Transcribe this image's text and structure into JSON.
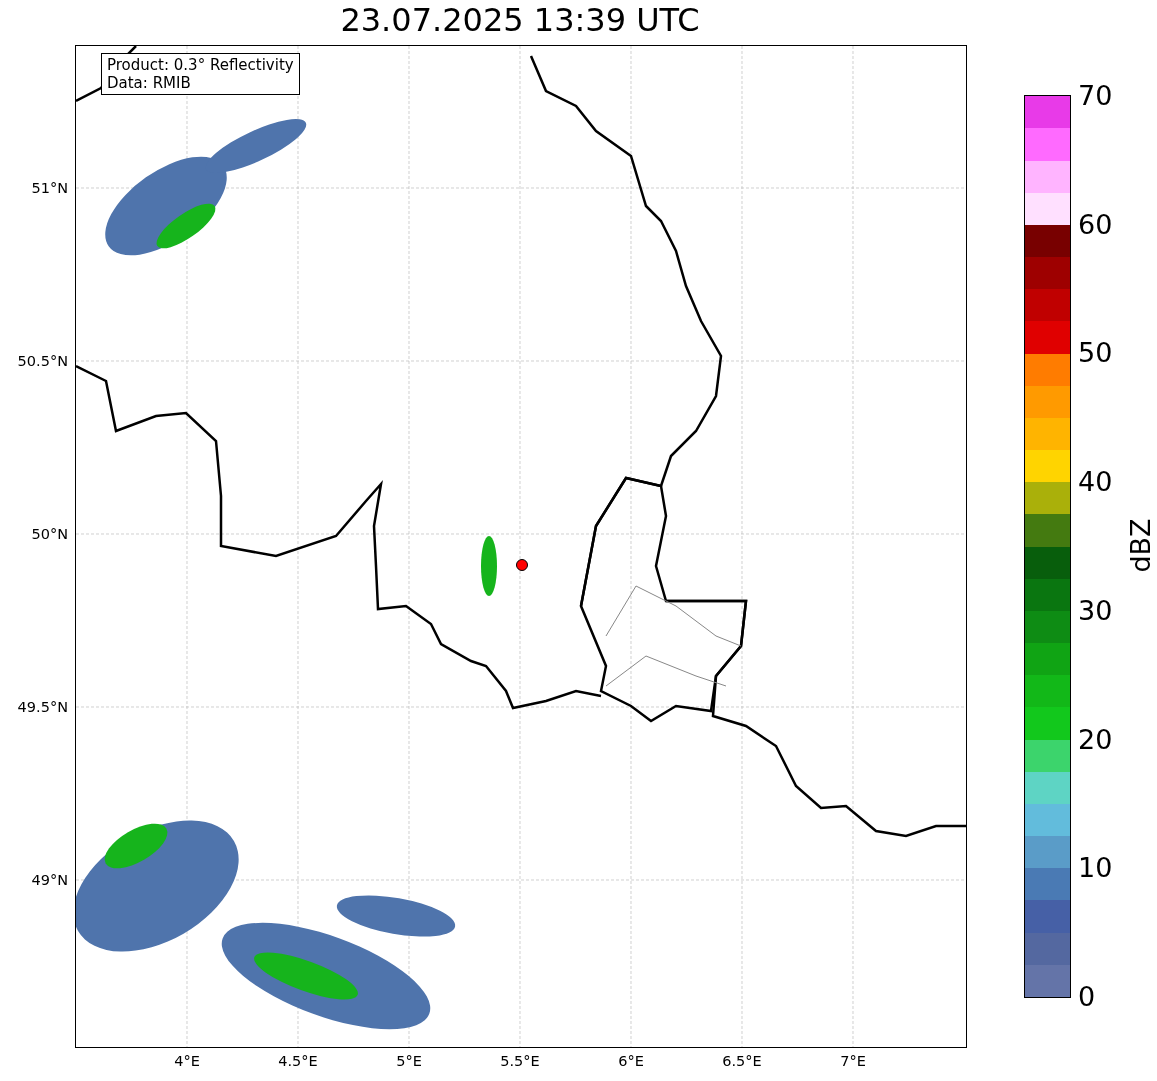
{
  "title": "23.07.2025 13:39 UTC",
  "map": {
    "legend": [
      "Product: 0.3° Reflectivity",
      "Data: RMIB"
    ],
    "y_ticks": [
      "51°N",
      "50.5°N",
      "50°N",
      "49.5°N",
      "49°N"
    ],
    "x_ticks": [
      "4°E",
      "4.5°E",
      "5°E",
      "5.5°E",
      "6°E",
      "6.5°E",
      "7°E"
    ]
  },
  "colorbar": {
    "label": "dBZ",
    "ticks": [
      "70",
      "60",
      "50",
      "40",
      "30",
      "20",
      "10",
      "0"
    ],
    "bins": [
      {
        "color": "#6474a8"
      },
      {
        "color": "#5468a0"
      },
      {
        "color": "#4660a6"
      },
      {
        "color": "#4a7ab4"
      },
      {
        "color": "#5a9cc8"
      },
      {
        "color": "#62bcdc"
      },
      {
        "color": "#5ed4c4"
      },
      {
        "color": "#3cd46c"
      },
      {
        "color": "#12c81c"
      },
      {
        "color": "#12b818"
      },
      {
        "color": "#10a414"
      },
      {
        "color": "#0e8c14"
      },
      {
        "color": "#0a7610"
      },
      {
        "color": "#085e0c"
      },
      {
        "color": "#447a10"
      },
      {
        "color": "#aab00a"
      },
      {
        "color": "#ffd400"
      },
      {
        "color": "#ffb400"
      },
      {
        "color": "#ff9a00"
      },
      {
        "color": "#ff7c00"
      },
      {
        "color": "#e00000"
      },
      {
        "color": "#c00000"
      },
      {
        "color": "#9e0000"
      },
      {
        "color": "#780000"
      },
      {
        "color": "#ffe0ff"
      },
      {
        "color": "#ffb4ff"
      },
      {
        "color": "#ff6aff"
      },
      {
        "color": "#e83ae8"
      }
    ]
  }
}
